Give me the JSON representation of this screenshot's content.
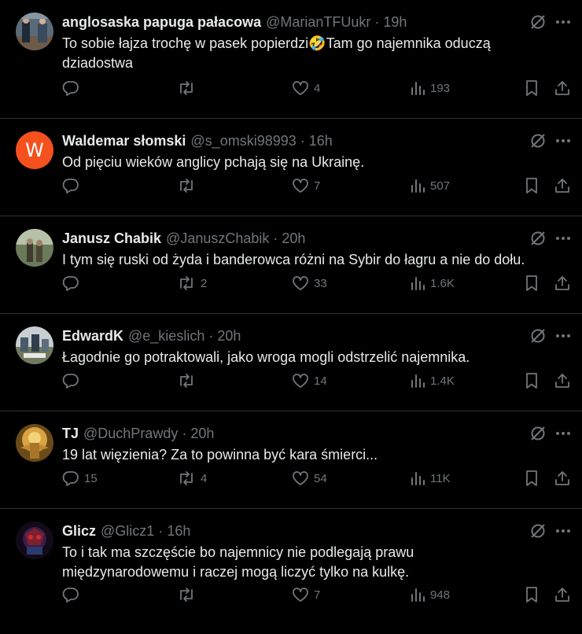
{
  "tweets": [
    {
      "name": "anglosaska papuga pałacowa",
      "handle": "@MarianTFUukr",
      "time": "19h",
      "text_lines": [
        "To sobie łajza trochę w pasek popierdzi🤣Tam go najemnika oduczą",
        "dziadostwa"
      ],
      "replies": "",
      "reposts": "",
      "likes": "4",
      "views": "193",
      "avatar": "photo"
    },
    {
      "name": "Waldemar słomski",
      "handle": "@s_omski98993",
      "time": "16h",
      "text_lines": [
        "Od pięciu wieków anglicy pchają się na Ukrainę."
      ],
      "replies": "",
      "reposts": "",
      "likes": "7",
      "views": "507",
      "avatar_letter": "W"
    },
    {
      "name": "Janusz Chabik",
      "handle": "@JanuszChabik",
      "time": "20h",
      "text_lines": [
        "I tym się ruski od żyda i banderowca różni na Sybir do łagru a nie do dołu."
      ],
      "replies": "",
      "reposts": "2",
      "likes": "33",
      "views": "1.6K",
      "avatar": "photo"
    },
    {
      "name": "EdwardK",
      "handle": "@e_kieslich",
      "time": "20h",
      "text_lines": [
        "Łagodnie go potraktowali, jako wroga mogli odstrzelić najemnika."
      ],
      "replies": "",
      "reposts": "",
      "likes": "14",
      "views": "1.4K",
      "avatar": "photo"
    },
    {
      "name": "TJ",
      "handle": "@DuchPrawdy",
      "time": "20h",
      "text_lines": [
        "19 lat więzienia? Za to powinna być kara śmierci..."
      ],
      "replies": "15",
      "reposts": "4",
      "likes": "54",
      "views": "11K",
      "avatar": "photo"
    },
    {
      "name": "Glicz",
      "handle": "@Glicz1",
      "time": "16h",
      "text_lines": [
        "To i tak ma szczęście bo najemnicy nie podlegają prawu",
        "międzynarodowemu i raczej mogą liczyć tylko na kulkę."
      ],
      "replies": "",
      "reposts": "",
      "likes": "7",
      "views": "948",
      "avatar": "photo"
    }
  ],
  "separator": "·",
  "colors": {
    "background": "#000000",
    "text": "#e7e9ea",
    "muted": "#71767b",
    "border": "#2f3336",
    "avatar_letter_bg": "#f4511e"
  },
  "icons": [
    "grok-icon",
    "more-icon",
    "reply-icon",
    "repost-icon",
    "like-icon",
    "views-icon",
    "bookmark-icon",
    "share-icon"
  ]
}
